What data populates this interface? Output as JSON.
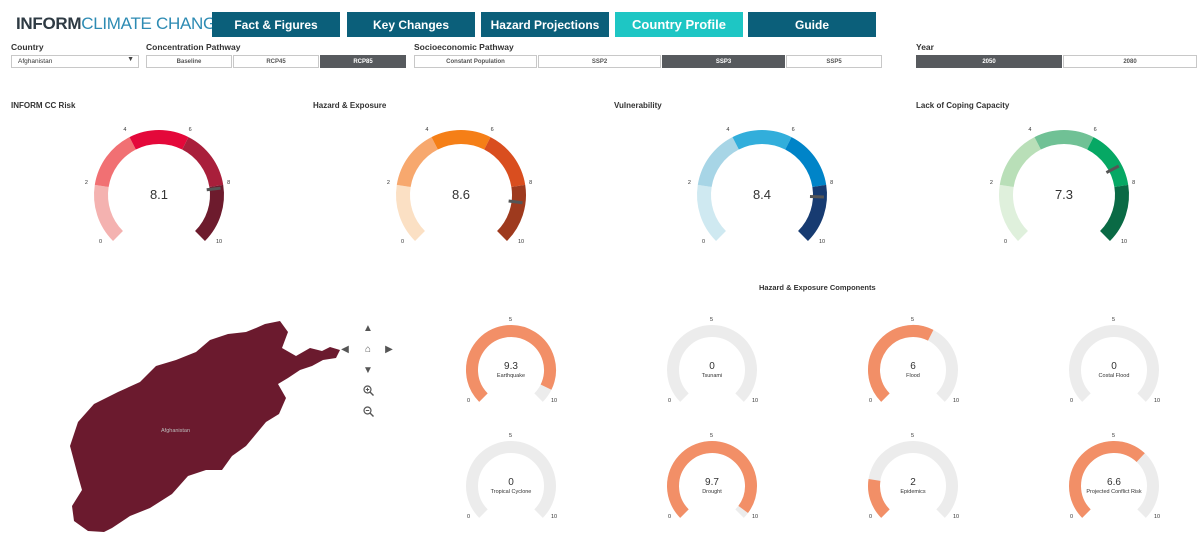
{
  "header": {
    "logo_part1": "INFORM",
    "logo_part2": "CLIMATE CHANGE",
    "tabs": [
      "Fact & Figures",
      "Key Changes",
      "Hazard Projections",
      "Country Profile",
      "Guide"
    ],
    "active_tab": "Country Profile"
  },
  "filters": {
    "country_label": "Country",
    "country_value": "Afghanistan",
    "concentration_label": "Concentration Pathway",
    "concentration_options": [
      "Baseline",
      "RCP45",
      "RCP85"
    ],
    "concentration_selected": "RCP85",
    "socio_label": "Socioeconomic Pathway",
    "socio_options": [
      "Constant Population",
      "SSP2",
      "SSP3",
      "SSP5"
    ],
    "socio_selected": "SSP3",
    "year_label": "Year",
    "year_options": [
      "2050",
      "2080"
    ],
    "year_selected": "2050"
  },
  "main_gauges": [
    {
      "title": "INFORM CC Risk",
      "value": "8.1",
      "num": 8.1,
      "ticks": [
        "2",
        "4",
        "6",
        "8",
        "10",
        "0"
      ],
      "colors": [
        "#f4b2b0",
        "#f17073",
        "#e4083a",
        "#a91f3b",
        "#6d1b2d"
      ]
    },
    {
      "title": "Hazard & Exposure",
      "value": "8.6",
      "num": 8.6,
      "ticks": [
        "2",
        "4",
        "6",
        "8",
        "10",
        "0"
      ],
      "colors": [
        "#fbe0c4",
        "#f7a86e",
        "#f57f17",
        "#d94e1f",
        "#9e3a1e"
      ]
    },
    {
      "title": "Vulnerability",
      "value": "8.4",
      "num": 8.4,
      "ticks": [
        "2",
        "4",
        "6",
        "8",
        "10",
        "0"
      ],
      "colors": [
        "#cfe9f1",
        "#a7d5e6",
        "#32aedb",
        "#0084c8",
        "#173b71"
      ]
    },
    {
      "title": "Lack of Coping Capacity",
      "value": "7.3",
      "num": 7.3,
      "ticks": [
        "2",
        "4",
        "6",
        "8",
        "10",
        "0"
      ],
      "colors": [
        "#dff0dc",
        "#b9dfb8",
        "#70c195",
        "#06a864",
        "#0a6a45"
      ]
    }
  ],
  "components": {
    "title": "Hazard & Exposure Components",
    "fill_color": "#f28f67",
    "track_color": "#ececec",
    "tick_min": "0",
    "tick_mid": "5",
    "tick_max": "10",
    "items": [
      {
        "name": "Earthquake",
        "value": "9.3",
        "num": 9.3
      },
      {
        "name": "Tsunami",
        "value": "0",
        "num": 0
      },
      {
        "name": "Flood",
        "value": "6",
        "num": 6
      },
      {
        "name": "Costal Flood",
        "value": "0",
        "num": 0
      },
      {
        "name": "Tropical Cyclone",
        "value": "0",
        "num": 0
      },
      {
        "name": "Drought",
        "value": "9.7",
        "num": 9.7
      },
      {
        "name": "Epidemics",
        "value": "2",
        "num": 2
      },
      {
        "name": "Projected Conflict Risk",
        "value": "6.6",
        "num": 6.6
      }
    ]
  },
  "map": {
    "country_label": "Afghanistan",
    "fill_color": "#6b1a2e"
  }
}
